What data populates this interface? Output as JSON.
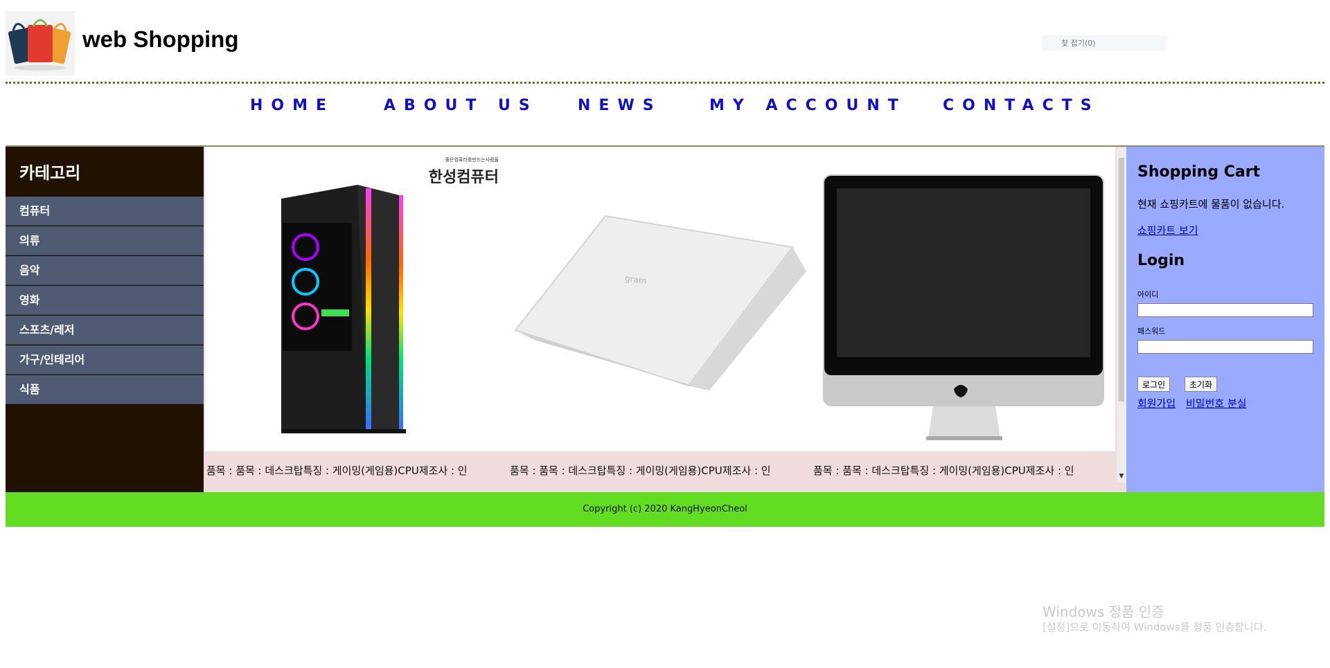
{
  "header": {
    "site_title": "web Shopping",
    "search_placeholder": "찾 접기(0)"
  },
  "nav": {
    "items": [
      "HOME",
      "ABOUT US",
      "NEWS",
      "MY ACCOUNT",
      "CONTACTS"
    ]
  },
  "sidebar": {
    "title": "카테고리",
    "items": [
      "컴퓨터",
      "의류",
      "음악",
      "영화",
      "스포츠/레저",
      "가구/인테리어",
      "식품"
    ]
  },
  "products": {
    "items": [
      {
        "caption": "품목 : 품목 : 데스크탑특징 : 게이밍(게임용)CPU제조사 : 인",
        "brand_line1": "좋은컴퓨터를만드는사람들",
        "brand_line2": "한성컴퓨터"
      },
      {
        "caption": "품목 : 품목 : 데스크탑특징 : 게이밍(게임용)CPU제조사 : 인",
        "laptop_logo": "gram"
      },
      {
        "caption": "품목 : 품목 : 데스크탑특징 : 게이밍(게임용)CPU제조사 : 인"
      }
    ]
  },
  "cart": {
    "title": "Shopping Cart",
    "empty_text": "현재 쇼핑카트에 물품이 없습니다.",
    "view_link": "쇼핑카트 보기"
  },
  "login": {
    "title": "Login",
    "id_label": "아이디",
    "id_value": "",
    "pw_label": "패스워드",
    "pw_value": "",
    "login_button": "로그인",
    "reset_button": "초기화",
    "signup_link": "회원가입",
    "lost_pw_link": "비밀번호 분실"
  },
  "footer": {
    "copyright": "Copyright (c) 2020 KangHyeonCheol"
  },
  "watermark": {
    "line1": "Windows 정품 인증",
    "line2": "[설정]으로 이동하여 Windows를 정품 인증합니다."
  },
  "colors": {
    "sidebar_bg": "#211100",
    "category_bg": "#4f5b73",
    "right_panel_bg": "#99aaff",
    "footer_bg": "#63dd22",
    "nav_link": "#1010c8",
    "product_caption_bg": "#f0dcdc"
  },
  "icons": [
    "shopping-bags-logo-icon",
    "scroll-down-arrow-icon"
  ]
}
